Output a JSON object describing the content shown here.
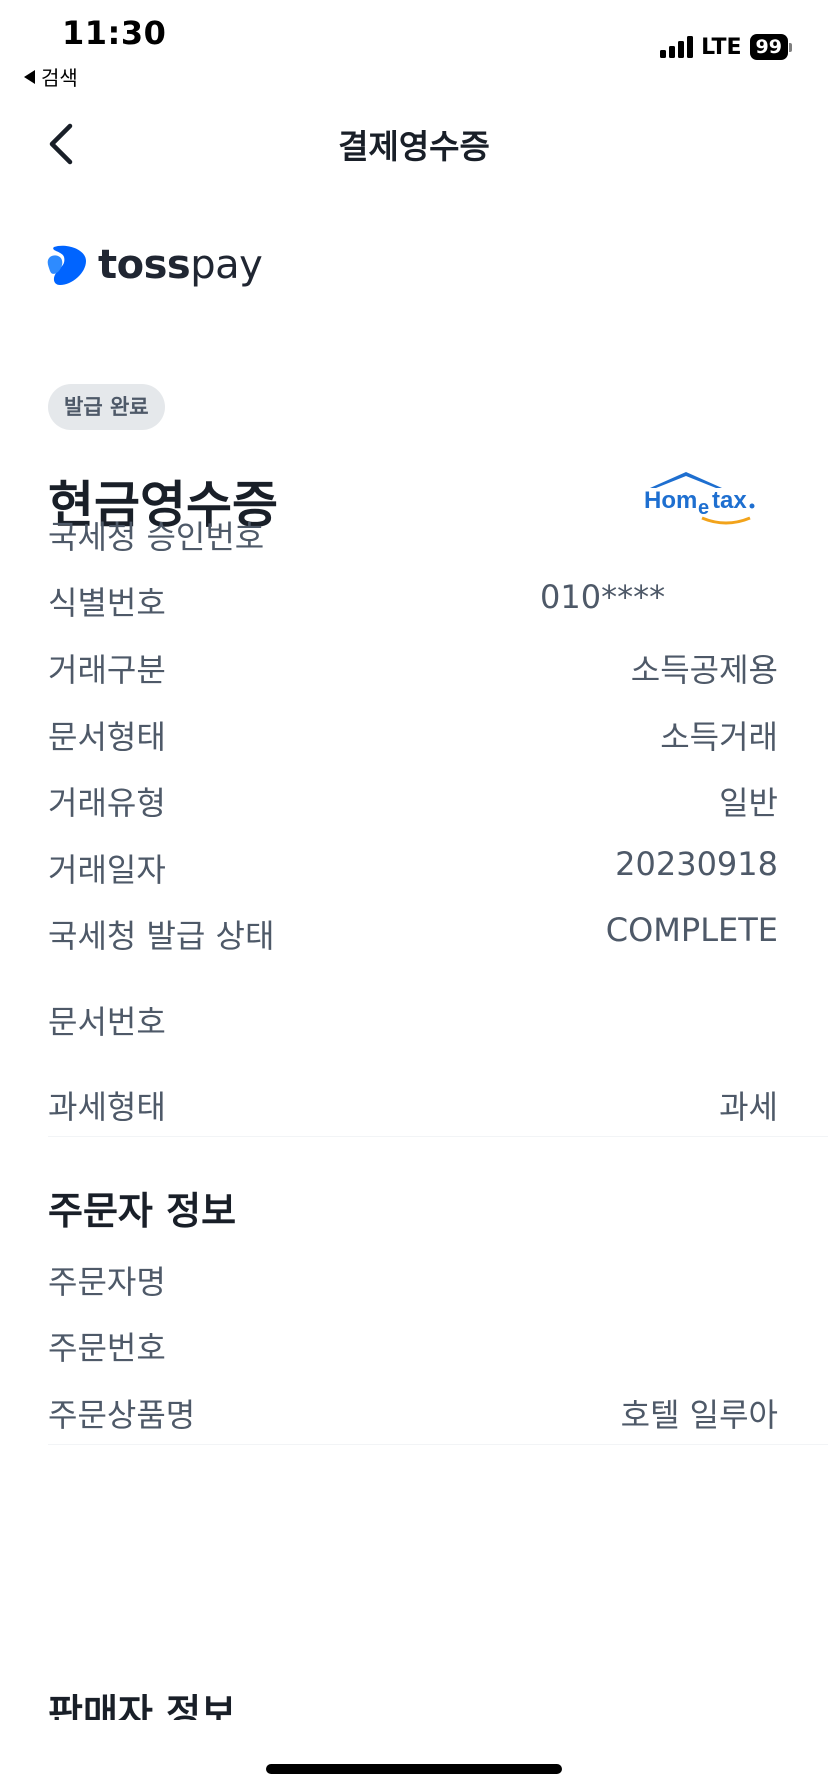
{
  "status_bar": {
    "time": "11:30",
    "back_app": "검색",
    "network": "LTE",
    "battery": "99"
  },
  "nav": {
    "title": "결제영수증",
    "back_icon": "chevron-left-icon"
  },
  "brand": {
    "logo_text_bold": "toss",
    "logo_text_light": "pay",
    "accent_color": "#0064ff"
  },
  "receipt": {
    "badge": "발급 완료",
    "title": "현금영수증",
    "hometax_logo": "Hometax",
    "rows": [
      {
        "label": "국세청 승인번호",
        "value": ""
      },
      {
        "label": "식별번호",
        "value": "010****"
      },
      {
        "label": "거래구분",
        "value": "소득공제용"
      },
      {
        "label": "문서형태",
        "value": "소득거래"
      },
      {
        "label": "거래유형",
        "value": "일반"
      },
      {
        "label": "거래일자",
        "value": "20230918"
      },
      {
        "label": "국세청 발급 상태",
        "value": "COMPLETE"
      },
      {
        "label": "문서번호",
        "value": ""
      },
      {
        "label": "과세형태",
        "value": "과세"
      }
    ]
  },
  "orderer": {
    "title": "주문자 정보",
    "rows": [
      {
        "label": "주문자명",
        "value": ""
      },
      {
        "label": "주문번호",
        "value": ""
      },
      {
        "label": "주문상품명",
        "value": "호텔 일루아"
      }
    ]
  },
  "seller": {
    "title": "판매자 정보"
  }
}
